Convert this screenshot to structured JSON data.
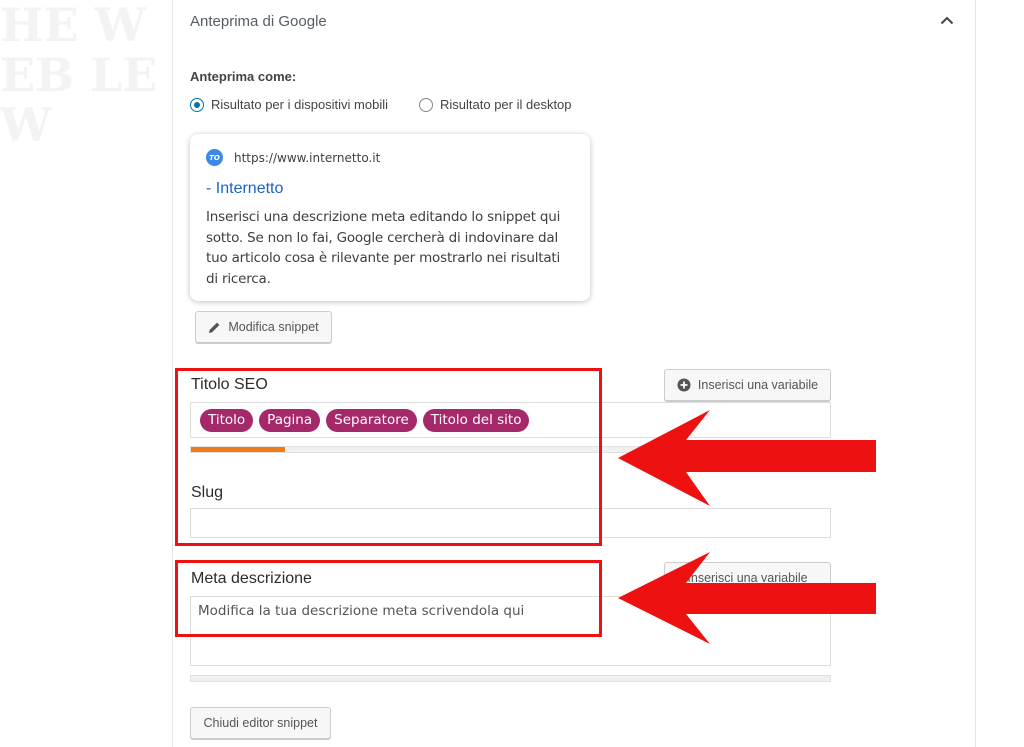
{
  "panel": {
    "title": "Anteprima di Google",
    "collapse_icon": "chevron-up-icon"
  },
  "preview": {
    "label": "Anteprima come:",
    "options": [
      {
        "label": "Risultato per i dispositivi mobili",
        "selected": true
      },
      {
        "label": "Risultato per il desktop",
        "selected": false
      }
    ]
  },
  "snippet": {
    "favicon_text": "TO",
    "url": "https://www.internetto.it",
    "title": "- Internetto",
    "description": "Inserisci una descrizione meta editando lo snippet qui sotto. Se non lo fai, Google cercherà di indovinare dal tuo articolo cosa è rilevante per mostrarlo nei risultati di ricerca."
  },
  "buttons": {
    "edit_snippet": "Modifica snippet",
    "insert_variable": "Inserisci una variabile",
    "close_editor": "Chiudi editor snippet"
  },
  "seo_title": {
    "label": "Titolo SEO",
    "pills": [
      "Titolo",
      "Pagina",
      "Separatore",
      "Titolo del sito"
    ],
    "progress": 0.147
  },
  "slug": {
    "label": "Slug",
    "value": ""
  },
  "meta_description": {
    "label": "Meta descrizione",
    "placeholder": "Modifica la tua descrizione meta scrivendola qui",
    "progress": 0
  },
  "annotation": {
    "color": "#ee1111"
  },
  "colors": {
    "pill": "#a4286a",
    "progress": "#ee7c1b",
    "link": "#1e62c6",
    "radio": "#0073aa"
  },
  "background_text": "HE WEB LEW"
}
